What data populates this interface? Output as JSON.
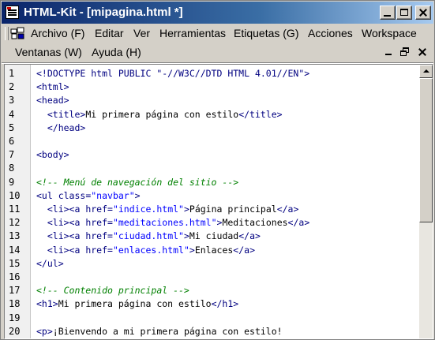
{
  "window": {
    "title": "HTML-Kit - [mipagina.html *]"
  },
  "menubar": {
    "row1": [
      "Archivo (F)",
      "Editar",
      "Ver",
      "Herramientas",
      "Etiquetas (G)",
      "Acciones",
      "Workspace"
    ],
    "row2": [
      "Ventanas (W)",
      "Ayuda (H)"
    ]
  },
  "editor": {
    "line_numbers": [
      "1",
      "2",
      "3",
      "4",
      "5",
      "6",
      "7",
      "8",
      "9",
      "10",
      "11",
      "12",
      "13",
      "14",
      "15",
      "16",
      "17",
      "18",
      "19",
      "20"
    ],
    "lines": [
      [
        [
          "doctype",
          "<!DOCTYPE html PUBLIC \"-//W3C//DTD HTML 4.01//EN\">"
        ]
      ],
      [
        [
          "tag",
          "<html>"
        ]
      ],
      [
        [
          "tag",
          "<head>"
        ]
      ],
      [
        [
          "text",
          "  "
        ],
        [
          "tag",
          "<title>"
        ],
        [
          "text",
          "Mi primera página con estilo"
        ],
        [
          "tag",
          "</title>"
        ]
      ],
      [
        [
          "text",
          "  "
        ],
        [
          "tag",
          "</head>"
        ]
      ],
      [],
      [
        [
          "tag",
          "<body>"
        ]
      ],
      [],
      [
        [
          "comment",
          "<!-- Menú de navegación del sitio -->"
        ]
      ],
      [
        [
          "tag",
          "<ul "
        ],
        [
          "attr",
          "class="
        ],
        [
          "val",
          "\"navbar\""
        ],
        [
          "tag",
          ">"
        ]
      ],
      [
        [
          "text",
          "  "
        ],
        [
          "tag",
          "<li><a "
        ],
        [
          "attr",
          "href="
        ],
        [
          "val",
          "\"indice.html\""
        ],
        [
          "tag",
          ">"
        ],
        [
          "text",
          "Página principal"
        ],
        [
          "tag",
          "</a>"
        ]
      ],
      [
        [
          "text",
          "  "
        ],
        [
          "tag",
          "<li><a "
        ],
        [
          "attr",
          "href="
        ],
        [
          "val",
          "\"meditaciones.html\""
        ],
        [
          "tag",
          ">"
        ],
        [
          "text",
          "Meditaciones"
        ],
        [
          "tag",
          "</a>"
        ]
      ],
      [
        [
          "text",
          "  "
        ],
        [
          "tag",
          "<li><a "
        ],
        [
          "attr",
          "href="
        ],
        [
          "val",
          "\"ciudad.html\""
        ],
        [
          "tag",
          ">"
        ],
        [
          "text",
          "Mi ciudad"
        ],
        [
          "tag",
          "</a>"
        ]
      ],
      [
        [
          "text",
          "  "
        ],
        [
          "tag",
          "<li><a "
        ],
        [
          "attr",
          "href="
        ],
        [
          "val",
          "\"enlaces.html\""
        ],
        [
          "tag",
          ">"
        ],
        [
          "text",
          "Enlaces"
        ],
        [
          "tag",
          "</a>"
        ]
      ],
      [
        [
          "tag",
          "</ul>"
        ]
      ],
      [],
      [
        [
          "comment",
          "<!-- Contenido principal -->"
        ]
      ],
      [
        [
          "tag",
          "<h1>"
        ],
        [
          "text",
          "Mi primera página con estilo"
        ],
        [
          "tag",
          "</h1>"
        ]
      ],
      [],
      [
        [
          "tag",
          "<p>"
        ],
        [
          "text",
          "¡Bienvendo a mi primera página con estilo!"
        ]
      ]
    ]
  },
  "icons": [
    "app-icon",
    "toolbar-icon",
    "minimize-icon",
    "maximize-icon",
    "close-icon",
    "scroll-up-icon"
  ]
}
